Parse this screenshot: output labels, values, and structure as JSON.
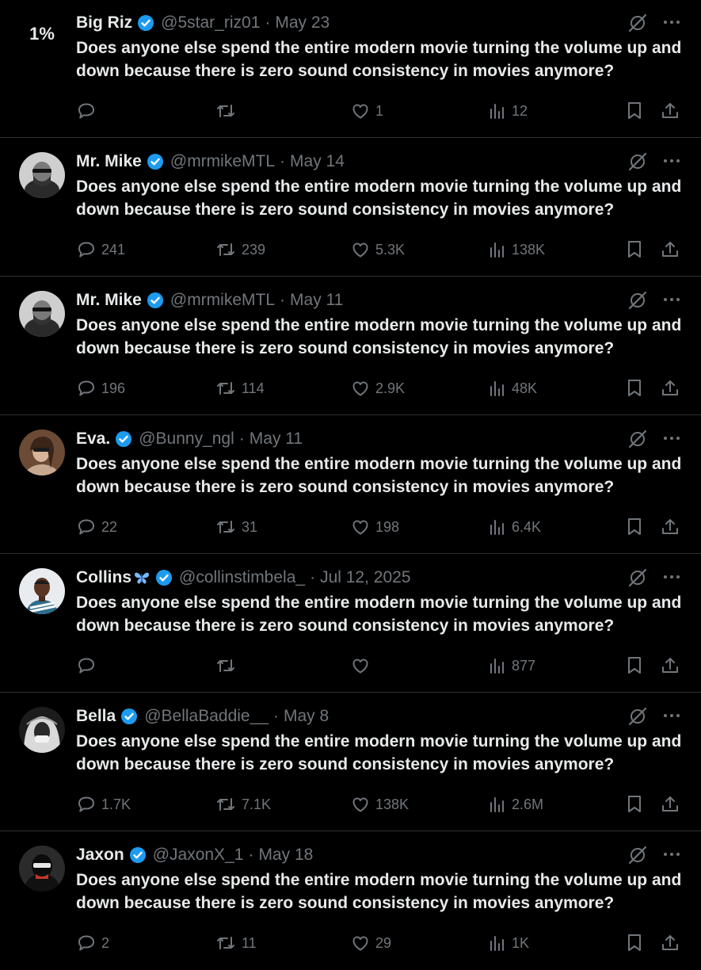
{
  "tweet_text": "Does anyone else spend the entire modern movie turning the volume up and down because there is zero sound consistency in movies anymore?",
  "tweets": [
    {
      "avatar_text": "1%",
      "name": "Big Riz",
      "handle": "@5star_riz01",
      "date": "May 23",
      "replies": "",
      "reposts": "",
      "likes": "1",
      "views": "12"
    },
    {
      "avatar_text": "",
      "name": "Mr. Mike",
      "handle": "@mrmikeMTL",
      "date": "May 14",
      "replies": "241",
      "reposts": "239",
      "likes": "5.3K",
      "views": "138K"
    },
    {
      "avatar_text": "",
      "name": "Mr. Mike",
      "handle": "@mrmikeMTL",
      "date": "May 11",
      "replies": "196",
      "reposts": "114",
      "likes": "2.9K",
      "views": "48K"
    },
    {
      "avatar_text": "",
      "name": "Eva.",
      "handle": "@Bunny_ngl",
      "date": "May 11",
      "replies": "22",
      "reposts": "31",
      "likes": "198",
      "views": "6.4K"
    },
    {
      "avatar_text": "",
      "name": "Collins",
      "handle": "@collinstimbela_",
      "date": "Jul 12, 2025",
      "replies": "",
      "reposts": "",
      "likes": "",
      "views": "877"
    },
    {
      "avatar_text": "",
      "name": "Bella",
      "handle": "@BellaBaddie__",
      "date": "May 8",
      "replies": "1.7K",
      "reposts": "7.1K",
      "likes": "138K",
      "views": "2.6M"
    },
    {
      "avatar_text": "",
      "name": "Jaxon",
      "handle": "@JaxonX_1",
      "date": "May 18",
      "replies": "2",
      "reposts": "11",
      "likes": "29",
      "views": "1K"
    }
  ],
  "dot_separator": "·",
  "colors": {
    "background": "#000000",
    "text": "#e7e9ea",
    "muted": "#71767b",
    "verified": "#1d9bf0",
    "divider": "#2f3336"
  },
  "icons": [
    "verified-badge-icon",
    "grok-icon",
    "more-icon",
    "reply-icon",
    "repost-icon",
    "like-icon",
    "views-icon",
    "bookmark-icon",
    "share-icon",
    "butterfly-emoji-icon"
  ]
}
